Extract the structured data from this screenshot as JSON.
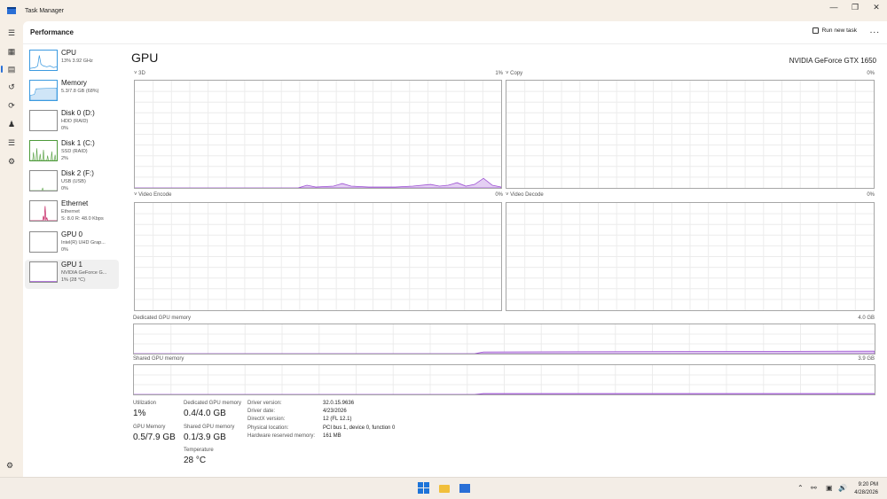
{
  "window": {
    "title": "Task Manager"
  },
  "header": {
    "section": "Performance",
    "run_new_task": "Run new task",
    "more": "..."
  },
  "devices": [
    {
      "name": "CPU",
      "sub1": "13% 3.92 GHz",
      "sub2": ""
    },
    {
      "name": "Memory",
      "sub1": "5.3/7.8 GB (68%)",
      "sub2": ""
    },
    {
      "name": "Disk 0 (D:)",
      "sub1": "HDD (RAID)",
      "sub2": "0%"
    },
    {
      "name": "Disk 1 (C:)",
      "sub1": "SSD (RAID)",
      "sub2": "2%"
    },
    {
      "name": "Disk 2 (F:)",
      "sub1": "USB (USB)",
      "sub2": "0%"
    },
    {
      "name": "Ethernet",
      "sub1": "Ethernet",
      "sub2": "S: 8.0 R: 48.0 Kbps"
    },
    {
      "name": "GPU 0",
      "sub1": "Intel(R) UHD Grap...",
      "sub2": "0%"
    },
    {
      "name": "GPU 1",
      "sub1": "NVIDIA GeForce G...",
      "sub2": "1% (28 °C)"
    }
  ],
  "main": {
    "title": "GPU",
    "model": "NVIDIA GeForce GTX 1650",
    "engines": [
      {
        "label": "3D",
        "value": "1%"
      },
      {
        "label": "Copy",
        "value": "0%"
      },
      {
        "label": "Video Encode",
        "value": "0%"
      },
      {
        "label": "Video Decode",
        "value": "0%"
      }
    ],
    "dedicated": {
      "label": "Dedicated GPU memory",
      "value": "4.0 GB"
    },
    "shared": {
      "label": "Shared GPU memory",
      "value": "3.9 GB"
    }
  },
  "stats": {
    "utilization_label": "Utilization",
    "utilization": "1%",
    "gpu_memory_label": "GPU Memory",
    "gpu_memory": "0.5/7.9 GB",
    "dedicated_label": "Dedicated GPU memory",
    "dedicated": "0.4/4.0 GB",
    "shared_label": "Shared GPU memory",
    "shared": "0.1/3.9 GB",
    "temperature_label": "Temperature",
    "temperature": "28 °C"
  },
  "details": [
    {
      "label": "Driver version:",
      "value": "32.0.15.9636"
    },
    {
      "label": "Driver date:",
      "value": "4/23/2026"
    },
    {
      "label": "DirectX version:",
      "value": "12 (FL 12.1)"
    },
    {
      "label": "Physical location:",
      "value": "PCI bus 1, device 0, function 0"
    },
    {
      "label": "Hardware reserved memory:",
      "value": "161 MB"
    }
  ],
  "taskbar": {
    "time": "9:20 PM",
    "date": "4/28/2026"
  },
  "colors": {
    "accent": "#2a6fd6",
    "gpu_line": "#9b4fd1",
    "gpu_fill": "#e4cff3"
  }
}
